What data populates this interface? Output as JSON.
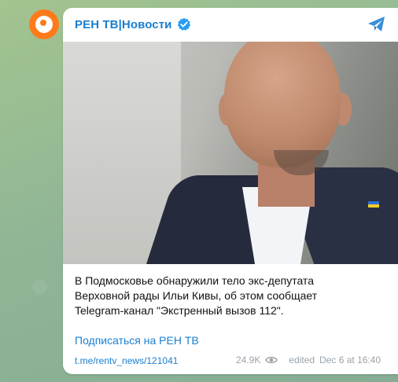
{
  "channel": {
    "name": "РЕН ТВ|Новости",
    "accent_color": "#1a7fd0",
    "avatar_color": "#ff7a1a"
  },
  "post": {
    "text_lines": [
      "В Подмосковье обнаружили тело экс-депутата",
      "Верховной рады Ильи Кивы, об этом сообщает",
      "Telegram-канал \"Экстренный вызов 112\"."
    ],
    "subscribe_label": "Подписаться на РЕН ТВ",
    "link_text": "t.me/rentv_news/121041",
    "views": "24.9K",
    "edited_label": "edited",
    "timestamp": "Dec 6 at 16:40"
  },
  "icons": {
    "verified": "verified-check-icon",
    "share": "share-arrow-icon",
    "views": "eye-icon"
  }
}
